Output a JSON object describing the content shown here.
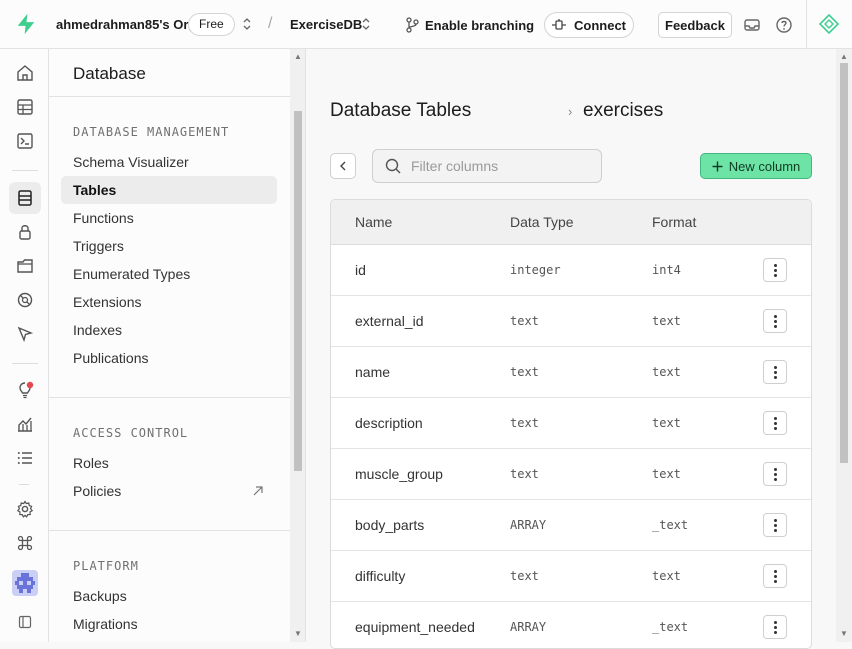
{
  "topbar": {
    "org_name": "ahmedrahman85's Org",
    "plan_badge": "Free",
    "separator": "/",
    "project_name": "ExerciseDB",
    "branching_label": "Enable branching",
    "connect_label": "Connect",
    "feedback_label": "Feedback"
  },
  "menu": {
    "title": "Database",
    "sections": [
      {
        "heading": "DATABASE MANAGEMENT",
        "items": [
          "Schema Visualizer",
          "Tables",
          "Functions",
          "Triggers",
          "Enumerated Types",
          "Extensions",
          "Indexes",
          "Publications"
        ]
      },
      {
        "heading": "ACCESS CONTROL",
        "items": [
          "Roles",
          "Policies"
        ]
      },
      {
        "heading": "PLATFORM",
        "items": [
          "Backups",
          "Migrations"
        ]
      }
    ],
    "active_item": "Tables"
  },
  "main": {
    "breadcrumb": [
      "Database Tables",
      "exercises"
    ],
    "breadcrumb_sep": "›",
    "filter_placeholder": "Filter columns",
    "new_column_label": "New column",
    "columns": [
      "Name",
      "Data Type",
      "Format"
    ],
    "rows": [
      {
        "name": "id",
        "type": "integer",
        "format": "int4"
      },
      {
        "name": "external_id",
        "type": "text",
        "format": "text"
      },
      {
        "name": "name",
        "type": "text",
        "format": "text"
      },
      {
        "name": "description",
        "type": "text",
        "format": "text"
      },
      {
        "name": "muscle_group",
        "type": "text",
        "format": "text"
      },
      {
        "name": "body_parts",
        "type": "ARRAY",
        "format": "_text"
      },
      {
        "name": "difficulty",
        "type": "text",
        "format": "text"
      },
      {
        "name": "equipment_needed",
        "type": "ARRAY",
        "format": "_text"
      }
    ]
  },
  "colors": {
    "accent": "#3ecf8e",
    "button_green": "#6ee3a6",
    "notification": "#e5484d"
  }
}
